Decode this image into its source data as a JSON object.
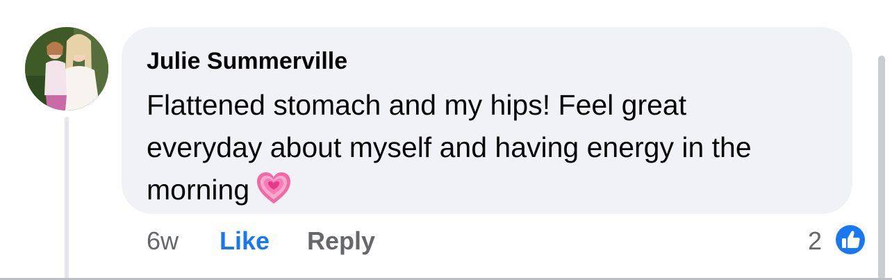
{
  "comment": {
    "author": "Julie Summerville",
    "text_lines": [
      "Flattened stomach and my hips! Feel great",
      "everyday about myself and having energy in the",
      "morning"
    ],
    "emoji_icon": "growing-heart-icon",
    "timestamp": "6w",
    "like_label": "Like",
    "reply_label": "Reply",
    "reaction_count": "2",
    "reaction_icon": "thumbs-up-icon",
    "avatar_icon": "profile-photo-avatar"
  },
  "colors": {
    "bubble_bg": "#f0f2f5",
    "primary_text": "#050505",
    "secondary_text": "#65676b",
    "accent_blue": "#1877f2",
    "thread_line": "#e4e6eb"
  }
}
